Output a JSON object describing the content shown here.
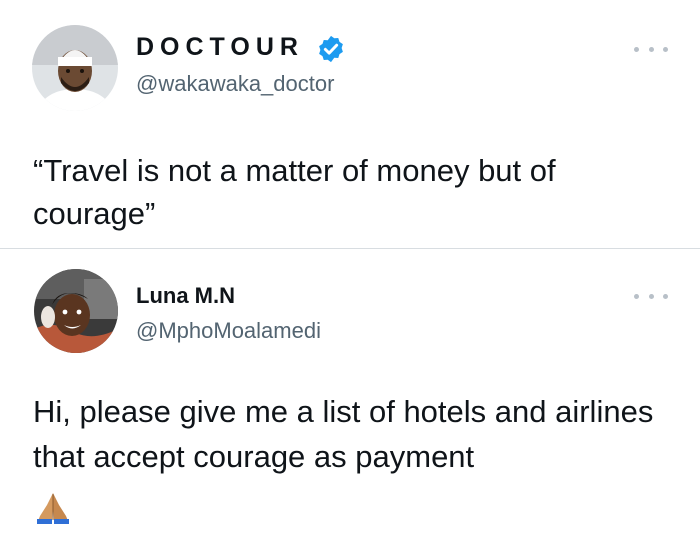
{
  "tweets": [
    {
      "display_name": "DOCTOUR",
      "verified": true,
      "handle": "@wakawaka_doctor",
      "text": "“Travel is not a matter of money but of courage”",
      "avatar_icon": "avatar-man-white-cap"
    },
    {
      "display_name": "Luna M.N",
      "verified": false,
      "handle": "@MphoMoalamedi",
      "text": "Hi, please give me a list of hotels and airlines that accept courage as payment",
      "emoji_icon": "folded-hands-emoji",
      "avatar_icon": "avatar-woman-selfie"
    }
  ],
  "colors": {
    "verified_badge": "#1d9bf0",
    "handle": "#536471",
    "text": "#0f1419",
    "divider": "#d8dde1"
  }
}
